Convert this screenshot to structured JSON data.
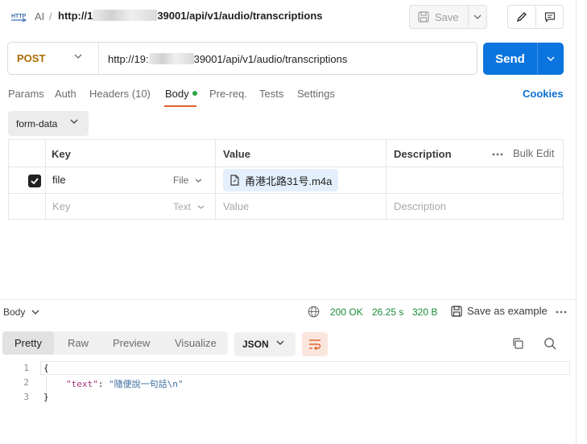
{
  "header": {
    "breadcrumb_parent": "AI",
    "breadcrumb_separator": "/",
    "url_title_prefix": "http://1",
    "url_title_suffix": "39001/api/v1/audio/transcriptions",
    "save_label": "Save"
  },
  "request": {
    "method": "POST",
    "url_prefix": "http://19:",
    "url_suffix": "39001/api/v1/audio/transcriptions",
    "send_label": "Send"
  },
  "tabs": [
    {
      "label": "Params"
    },
    {
      "label": "Auth"
    },
    {
      "label": "Headers",
      "count": "(10)"
    },
    {
      "label": "Body"
    },
    {
      "label": "Pre-req."
    },
    {
      "label": "Tests"
    },
    {
      "label": "Settings"
    }
  ],
  "cookies_label": "Cookies",
  "body_mode": "form-data",
  "params_table": {
    "columns": {
      "key": "Key",
      "value": "Value",
      "description": "Description"
    },
    "bulk_edit_label": "Bulk Edit",
    "rows": [
      {
        "checked": true,
        "key": "file",
        "type": "File",
        "value": "甬港北路31号.m4a",
        "description": ""
      }
    ],
    "placeholder_row": {
      "key": "Key",
      "type": "Text",
      "value": "Value",
      "description": "Description"
    }
  },
  "response": {
    "section_label": "Body",
    "status": "200 OK",
    "time": "26.25 s",
    "size": "320 B",
    "save_example_label": "Save as example",
    "view_tabs": [
      "Pretty",
      "Raw",
      "Preview",
      "Visualize"
    ],
    "format": "JSON",
    "lines": [
      {
        "num": "1",
        "text": "{"
      },
      {
        "num": "2",
        "key": "\"text\"",
        "colon": ": ",
        "value": "\"隨便說一句話\\n\""
      },
      {
        "num": "3",
        "text": "}"
      }
    ]
  },
  "colors": {
    "accent_orange": "#e0612a",
    "send_blue": "#0b74de",
    "method_post": "#a86d00",
    "status_green": "#1a8a3a",
    "link_blue": "#0b6fd1"
  }
}
